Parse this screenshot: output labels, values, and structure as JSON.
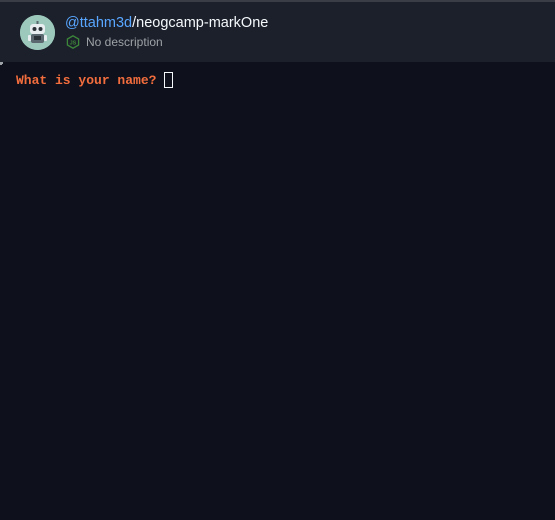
{
  "header": {
    "owner": "@ttahm3d",
    "separator": "/",
    "repo_name": "neogcamp-markOne",
    "description": "No description",
    "language_icon": "nodejs-icon",
    "avatar_icon": "robot-avatar-icon"
  },
  "terminal": {
    "prompt": "What is your name? "
  },
  "colors": {
    "background": "#0e101b",
    "header_bg": "#1c202b",
    "link": "#58a6ff",
    "prompt": "#f26d3d",
    "nodejs_green": "#3c873a"
  }
}
